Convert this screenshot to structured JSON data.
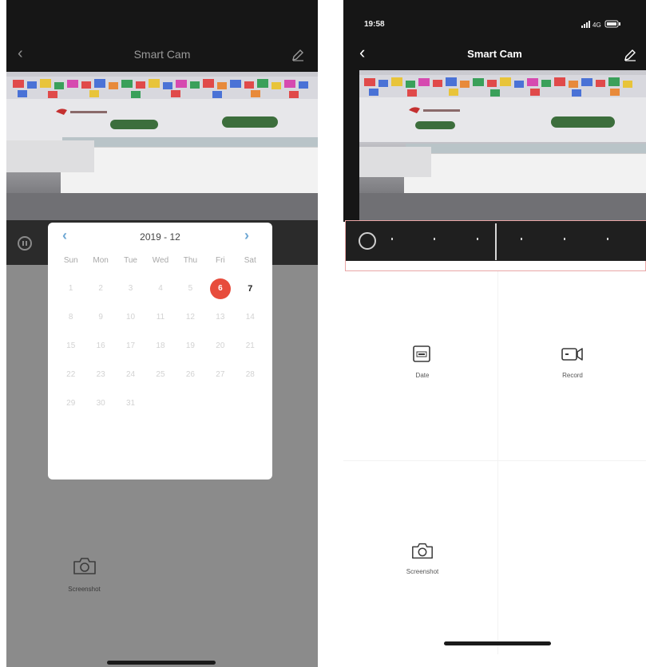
{
  "left_screen": {
    "title": "Smart Cam",
    "calendar": {
      "month_label": "2019 - 12",
      "weekdays": [
        "Sun",
        "Mon",
        "Tue",
        "Wed",
        "Thu",
        "Fri",
        "Sat"
      ],
      "days": [
        "1",
        "2",
        "3",
        "4",
        "5",
        "6",
        "7",
        "8",
        "9",
        "10",
        "11",
        "12",
        "13",
        "14",
        "15",
        "16",
        "17",
        "18",
        "19",
        "20",
        "21",
        "22",
        "23",
        "24",
        "25",
        "26",
        "27",
        "28",
        "29",
        "30",
        "31"
      ],
      "selected_day": "6",
      "enabled_days": [
        "6",
        "7"
      ]
    },
    "screenshot_label": "Screenshot"
  },
  "right_screen": {
    "status_time": "19:58",
    "network": "4G",
    "title": "Smart Cam",
    "features": [
      {
        "label": "Date",
        "icon": "calendar-icon"
      },
      {
        "label": "Record",
        "icon": "video-record-icon"
      },
      {
        "label": "Screenshot",
        "icon": "camera-icon"
      }
    ]
  },
  "colors": {
    "selected_day": "#e74c3c",
    "calendar_arrow": "#6fa8d4",
    "timeline_highlight": "#e9a6a6",
    "dark_bar": "#161616"
  }
}
